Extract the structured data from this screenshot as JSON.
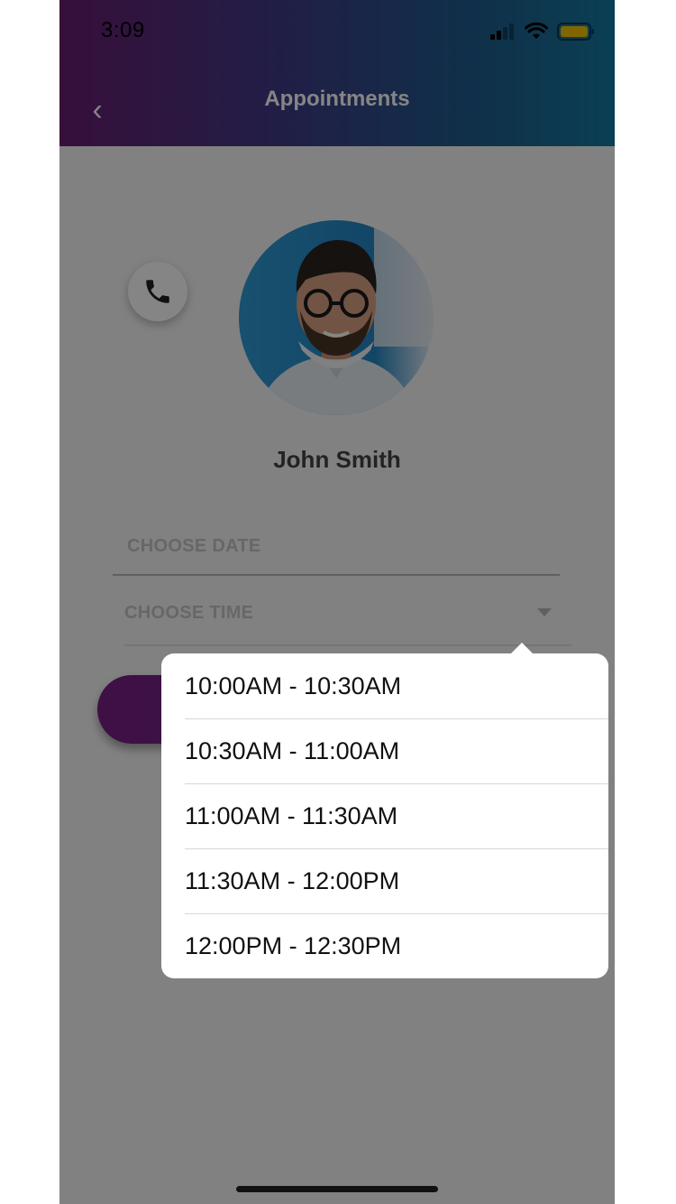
{
  "status_bar": {
    "time": "3:09"
  },
  "header": {
    "title": "Appointments",
    "back_icon": "‹"
  },
  "profile": {
    "name": "John Smith"
  },
  "form": {
    "date_label": "CHOOSE DATE",
    "time_label": "CHOOSE TIME"
  },
  "time_menu": {
    "options": [
      "10:00AM - 10:30AM",
      "10:30AM - 11:00AM",
      "11:00AM - 11:30AM",
      "11:30AM - 12:00PM",
      "12:00PM - 12:30PM"
    ]
  },
  "colors": {
    "header_start": "#6a1e72",
    "header_end": "#157aa0",
    "button": "#7a1f84",
    "battery": "#f5c400"
  }
}
